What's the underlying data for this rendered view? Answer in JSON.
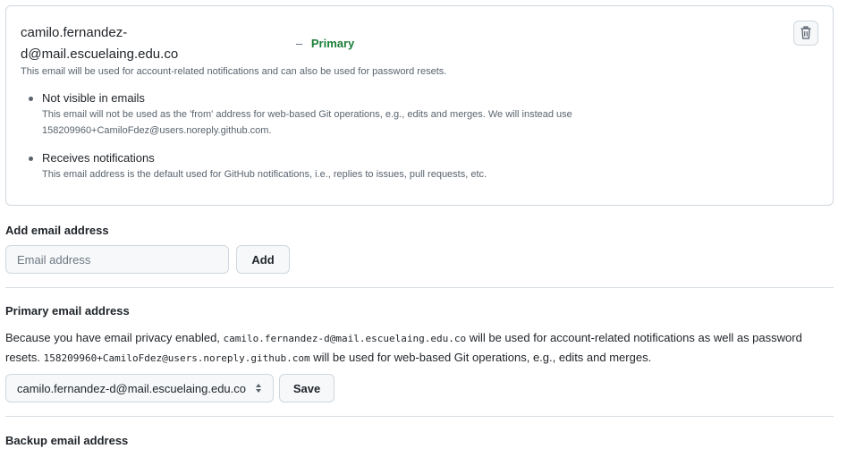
{
  "email_card": {
    "email_line1": "camilo.fernandez-",
    "email_line2": "d@mail.escuelaing.edu.co",
    "dash": "–",
    "primary_label": "Primary",
    "trash_icon": "trash-icon",
    "description": "This email will be used for account-related notifications and can also be used for password resets.",
    "bullets": [
      {
        "title": "Not visible in emails",
        "line1": "This email will not be used as the 'from' address for web-based Git operations, e.g., edits and merges. We will instead use",
        "line2": "158209960+CamiloFdez@users.noreply.github.com."
      },
      {
        "title": "Receives notifications",
        "line1": "This email address is the default used for GitHub notifications, i.e., replies to issues, pull requests, etc."
      }
    ]
  },
  "add_email": {
    "title": "Add email address",
    "placeholder": "Email address",
    "button": "Add"
  },
  "primary_email": {
    "title": "Primary email address",
    "para_part1": "Because you have email privacy enabled, ",
    "email_code": "camilo.fernandez-d@mail.escuelaing.edu.co",
    "para_part2": " will be used for account-related notifications as well as password resets. ",
    "noreply_code": "158209960+CamiloFdez@users.noreply.github.com",
    "para_part3": " will be used for web-based Git operations, e.g., edits and merges.",
    "select_value": "camilo.fernandez-d@mail.escuelaing.edu.co",
    "save_button": "Save"
  },
  "backup_email": {
    "title": "Backup email address"
  }
}
